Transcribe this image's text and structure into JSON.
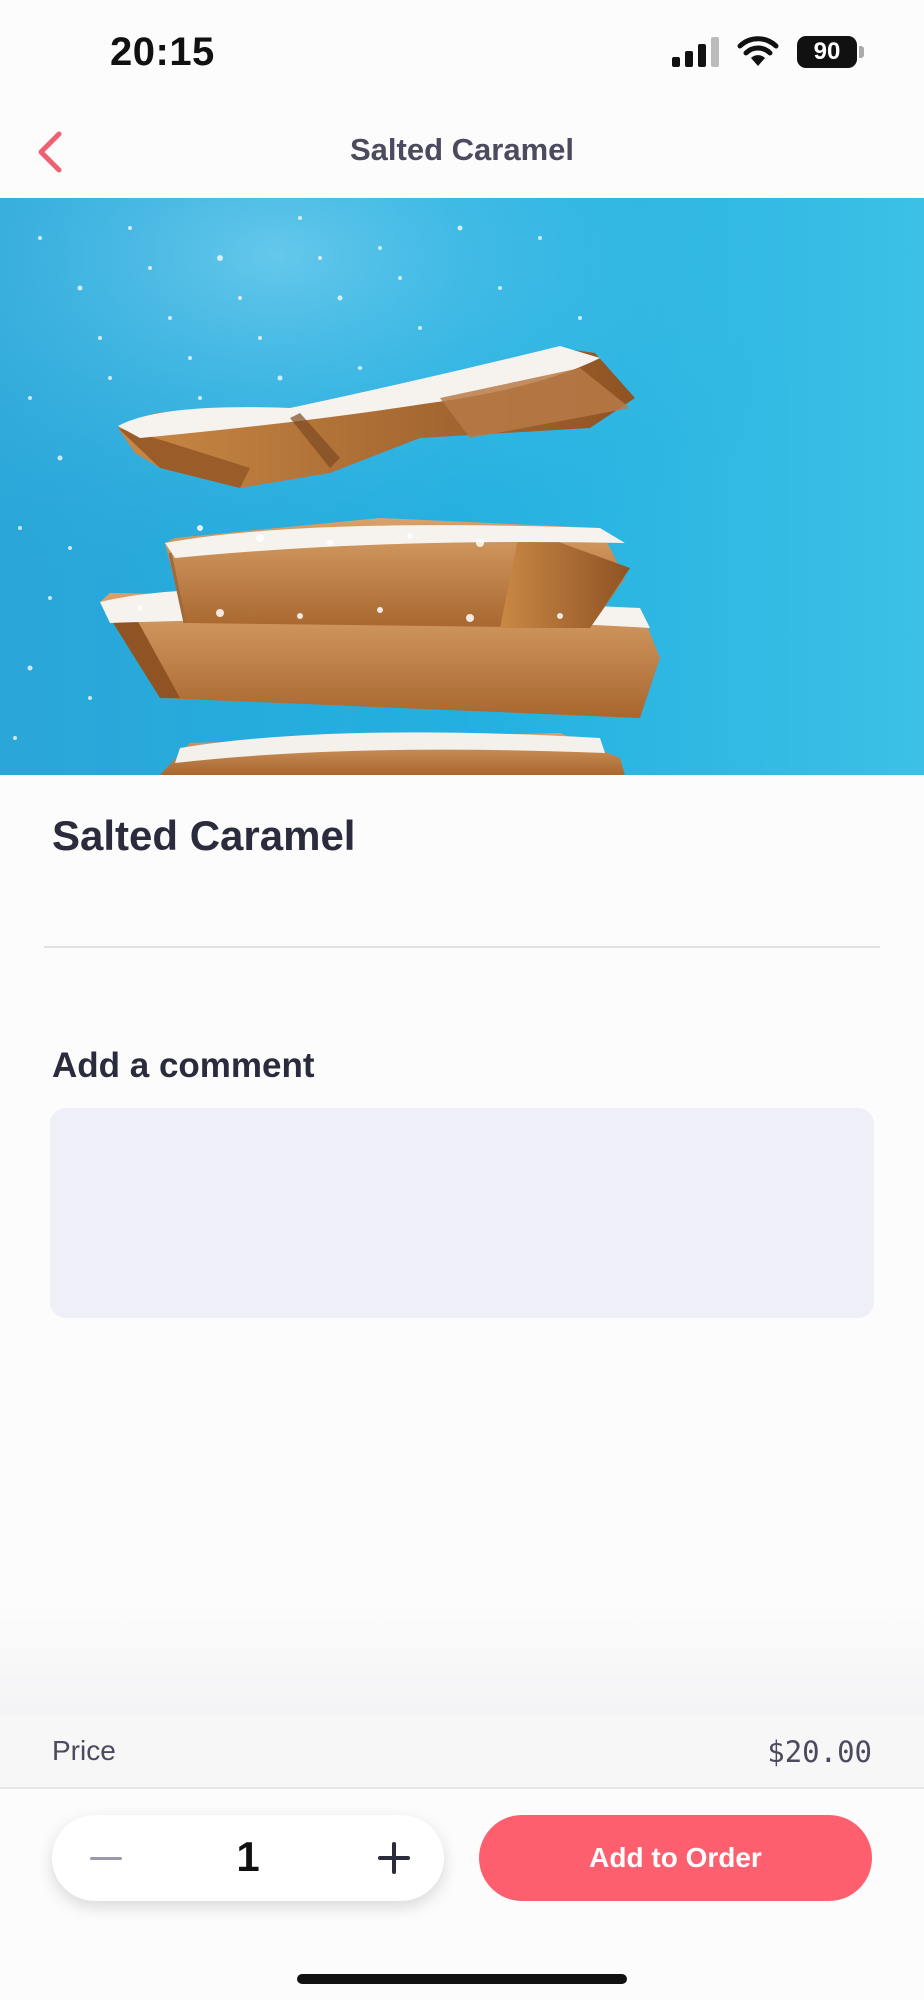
{
  "status_bar": {
    "time": "20:15",
    "battery": "90",
    "icons": [
      "signal-icon",
      "wifi-icon",
      "battery-icon"
    ]
  },
  "nav": {
    "title": "Salted Caramel",
    "back_icon": "chevron-left-icon",
    "accent_color": "#f0606e"
  },
  "hero": {
    "image_description": "Stack of powdered sugar-dusted caramel bars on blue background"
  },
  "product": {
    "title": "Salted Caramel"
  },
  "comment": {
    "label": "Add a comment",
    "value": "",
    "placeholder": ""
  },
  "price": {
    "label": "Price",
    "value": "$20.00"
  },
  "order": {
    "quantity": "1",
    "minus_icon": "minus-icon",
    "plus_icon": "plus-icon",
    "add_label": "Add to Order",
    "button_color": "#fd5f6f"
  }
}
